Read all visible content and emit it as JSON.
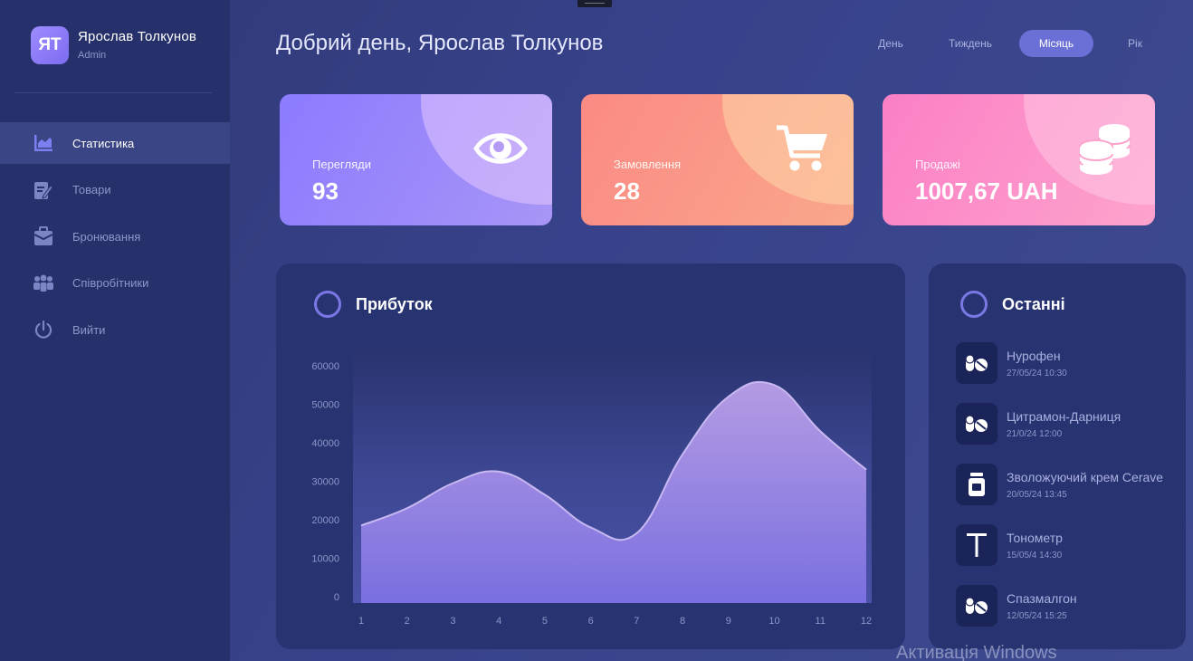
{
  "user": {
    "initials": "ЯТ",
    "name": "Ярослав Толкунов",
    "role": "Admin"
  },
  "sidebar": {
    "items": [
      {
        "label": "Статистика",
        "icon": "chart-icon",
        "active": true
      },
      {
        "label": "Товари",
        "icon": "products-icon",
        "active": false
      },
      {
        "label": "Бронювання",
        "icon": "booking-icon",
        "active": false
      },
      {
        "label": "Співробітники",
        "icon": "staff-icon",
        "active": false
      },
      {
        "label": "Вийти",
        "icon": "power-icon",
        "active": false
      }
    ]
  },
  "header": {
    "greeting": "Добрий день, Ярослав Толкунов",
    "periods": [
      "День",
      "Тиждень",
      "Місяць",
      "Рік"
    ],
    "active_period": "Місяць"
  },
  "cards": [
    {
      "label": "Перегляди",
      "value": "93",
      "icon": "eye-icon"
    },
    {
      "label": "Замовлення",
      "value": "28",
      "icon": "cart-icon"
    },
    {
      "label": "Продажі",
      "value": "1007,67 UAH",
      "icon": "coins-icon"
    }
  ],
  "profit": {
    "title": "Прибуток"
  },
  "chart_data": {
    "type": "area",
    "x": [
      "1",
      "2",
      "3",
      "4",
      "5",
      "6",
      "7",
      "8",
      "9",
      "10",
      "11",
      "12"
    ],
    "y_ticks": [
      "60000",
      "50000",
      "40000",
      "30000",
      "20000",
      "10000",
      "0"
    ],
    "ylim": [
      0,
      60000
    ],
    "grid": false,
    "series": [
      {
        "values": [
          18500,
          23000,
          29500,
          32500,
          26500,
          18000,
          16500,
          37000,
          52000,
          55000,
          43000,
          33000
        ]
      }
    ],
    "colors": {
      "fill_top": "#b49be3",
      "fill_bottom": "#7a6fe0",
      "line": "#c8b8f2"
    }
  },
  "recent": {
    "title": "Останні",
    "items": [
      {
        "name": "Нурофен",
        "date": " 27/05/24 10:30",
        "icon": "pills-icon"
      },
      {
        "name": "Цитрамон-Дарниця",
        "date": " 21/0/24 12:00",
        "icon": "pills-icon"
      },
      {
        "name": "Зволожуючий крем Cerave",
        "date": "20/05/24 13:45",
        "icon": "jar-icon"
      },
      {
        "name": "Тонометр",
        "date": "15/05/4 14:30",
        "icon": "letter-t-icon"
      },
      {
        "name": "Спазмалгон",
        "date": "12/05/24 15:25",
        "icon": "pills-icon"
      }
    ]
  },
  "watermark": "Активація Windows"
}
